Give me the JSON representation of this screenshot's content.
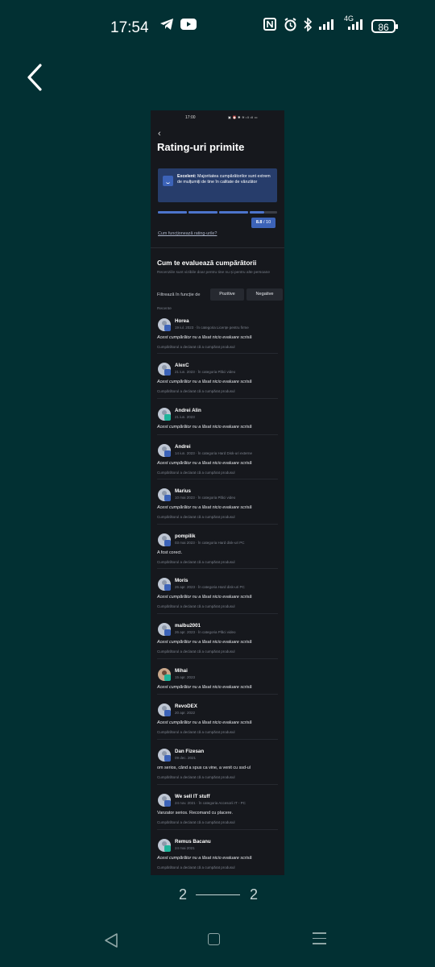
{
  "status_bar": {
    "time": "17:54",
    "network": "4G",
    "battery": "86"
  },
  "preview": {
    "status_time": "17:00",
    "title": "Rating-uri primite",
    "banner": {
      "label": "Excelent:",
      "text": "Majoritatea cumpărătorilor sunt extrem de mulțumiți de tine în calitate de vânzător"
    },
    "rating": {
      "score": "8.8",
      "max": "/ 10",
      "fraction": 0.88
    },
    "how_link": "Cum funcționează rating-urile?",
    "section_title": "Cum te evaluează cumpărătorii",
    "section_subtitle": "Recenziile sunt vizibile doar pentru tine nu și pentru alte persoane",
    "filter_label": "Filtrează în funcție de",
    "filter_positive": "Pozitive",
    "filter_negative": "Negative",
    "recent_label": "Recente",
    "reviews": [
      {
        "name": "Horea",
        "meta": "19 iul. 2023 · În categoria Licențe pentru firme",
        "comment": "Acest cumpărător nu a lăsat nicio evaluare scrisă",
        "italic": true,
        "note": "Cumpărătorul a declarat că a cumpărat produsul"
      },
      {
        "name": "AlexC",
        "meta": "21 iun. 2023 · În categoria Plăci video",
        "comment": "Acest cumpărător nu a lăsat nicio evaluare scrisă",
        "italic": true,
        "note": "Cumpărătorul a declarat că a cumpărat produsul"
      },
      {
        "name": "Andrei Alin",
        "meta": "21 iun. 2023",
        "comment": "Acest cumpărător nu a lăsat nicio evaluare scrisă",
        "italic": true,
        "note": ""
      },
      {
        "name": "Andrei",
        "meta": "14 iun. 2023 · În categoria Hard Disk-uri externe",
        "comment": "Acest cumpărător nu a lăsat nicio evaluare scrisă",
        "italic": true,
        "note": "Cumpărătorul a declarat că a cumpărat produsul"
      },
      {
        "name": "Marius",
        "meta": "10 mai 2023 · În categoria Plăci video",
        "comment": "Acest cumpărător nu a lăsat nicio evaluare scrisă",
        "italic": true,
        "note": "Cumpărătorul a declarat că a cumpărat produsul"
      },
      {
        "name": "pompilik",
        "meta": "03 mai 2023 · În categoria Hard disk-uri PC",
        "comment": "A fost corect.",
        "italic": false,
        "note": "Cumpărătorul a declarat că a cumpărat produsul"
      },
      {
        "name": "Moris",
        "meta": "26 apr. 2023 · În categoria Hard disk-uri PC",
        "comment": "Acest cumpărător nu a lăsat nicio evaluare scrisă",
        "italic": true,
        "note": "Cumpărătorul a declarat că a cumpărat produsul"
      },
      {
        "name": "malbu2001",
        "meta": "26 apr. 2023 · În categoria Plăci video",
        "comment": "Acest cumpărător nu a lăsat nicio evaluare scrisă",
        "italic": true,
        "note": "Cumpărătorul a declarat că a cumpărat produsul"
      },
      {
        "name": "Mihai",
        "meta": "15 apr. 2023",
        "comment": "Acest cumpărător nu a lăsat nicio evaluare scrisă",
        "italic": true,
        "note": ""
      },
      {
        "name": "RevoDEX",
        "meta": "20 apr. 2022",
        "comment": "Acest cumpărător nu a lăsat nicio evaluare scrisă",
        "italic": true,
        "note": "Cumpărătorul a declarat că a cumpărat produsul"
      },
      {
        "name": "Dan Fizesan",
        "meta": "09 dec. 2021",
        "comment": "om serios, când a spus ca vine, a venit cu ssd-ul",
        "italic": false,
        "note": "Cumpărătorul a declarat că a cumpărat produsul"
      },
      {
        "name": "We sell IT stuff",
        "meta": "24 nov. 2021 · În categoria Accesorii IT - PC",
        "comment": "Vanzator serios. Recomand cu placere.",
        "italic": false,
        "note": "Cumpărătorul a declarat că a cumpărat produsul"
      },
      {
        "name": "Remus Bacanu",
        "meta": "24 mai 2021",
        "comment": "Acest cumpărător nu a lăsat nicio evaluare scrisă",
        "italic": true,
        "note": "Cumpărătorul a declarat că a cumpărat produsul"
      }
    ]
  },
  "pager": {
    "current": "2",
    "total": "2"
  },
  "icons": [
    "back-arrow-icon",
    "telegram-icon",
    "youtube-icon",
    "nfc-icon",
    "alarm-icon",
    "bluetooth-icon",
    "signal-icon",
    "home-icon",
    "recent-apps-icon"
  ]
}
